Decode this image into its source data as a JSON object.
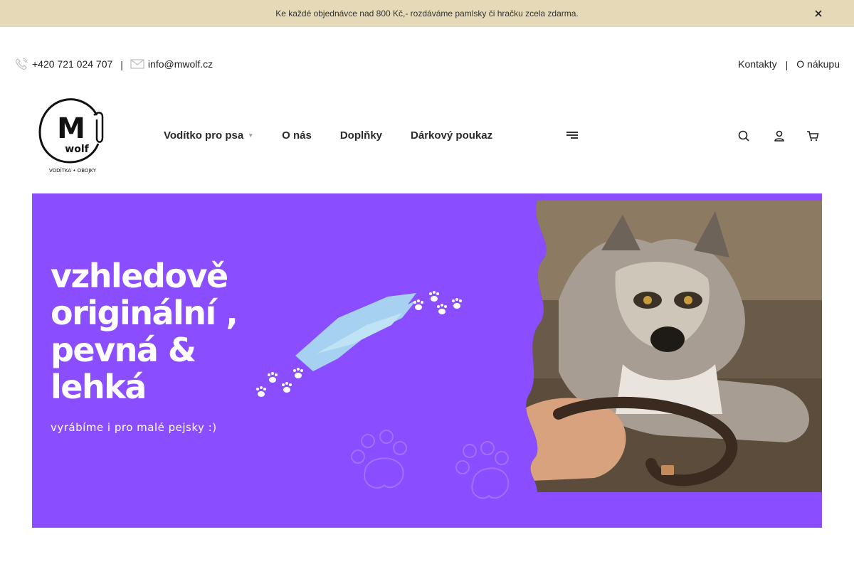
{
  "announcement": {
    "text": "Ke každé objednávce nad 800 Kč,- rozdáváme pamlsky či hračku zcela zdarma."
  },
  "topbar": {
    "phone": "+420 721 024 707",
    "separator": "|",
    "email": "info@mwolf.cz",
    "links": [
      "Kontakty",
      "O nákupu"
    ]
  },
  "logo": {
    "letter": "M",
    "word": "wolf",
    "tagline": "VODÍTKA • OBOJKY"
  },
  "nav": {
    "items": [
      {
        "label": "Vodítko pro psa",
        "has_dropdown": true
      },
      {
        "label": "O nás"
      },
      {
        "label": "Doplňky"
      },
      {
        "label": "Dárkový poukaz"
      }
    ],
    "icons": [
      "menu-icon",
      "search-icon",
      "user-icon",
      "cart-icon"
    ]
  },
  "hero": {
    "title_lines": [
      "vzhledově",
      "originální ,",
      "pevná &",
      "lehká"
    ],
    "subtitle": "vyrábíme i pro malé pejsky :)",
    "background": "#8a4dff",
    "accent": "#a8d8f0"
  }
}
